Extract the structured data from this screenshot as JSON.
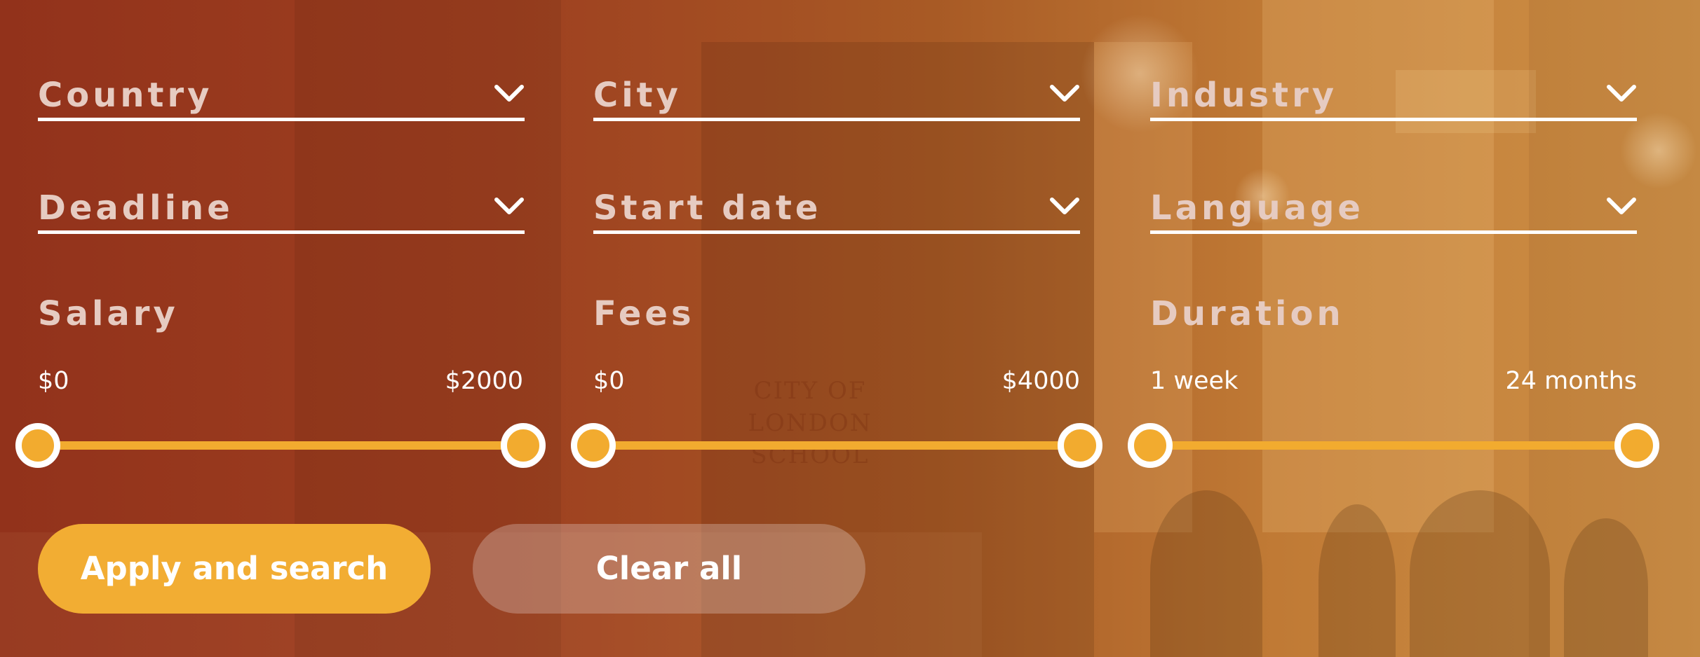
{
  "colors": {
    "accent": "#f2ab2f",
    "label": "#e6cbc1",
    "underline": "#ffffff",
    "background_left": "#92321b",
    "background_right": "#cf9248"
  },
  "background_sign": {
    "line1": "CITY OF LONDON",
    "line2": "SCHOOL"
  },
  "filters": {
    "country": {
      "label": "Country",
      "icon": "chevron-down-icon"
    },
    "city": {
      "label": "City",
      "icon": "chevron-down-icon"
    },
    "industry": {
      "label": "Industry",
      "icon": "chevron-down-icon"
    },
    "deadline": {
      "label": "Deadline",
      "icon": "chevron-down-icon"
    },
    "start_date": {
      "label": "Start date",
      "icon": "chevron-down-icon"
    },
    "language": {
      "label": "Language",
      "icon": "chevron-down-icon"
    }
  },
  "ranges": {
    "salary": {
      "title": "Salary",
      "min_label": "$0",
      "max_label": "$2000",
      "low_fraction": 0,
      "high_fraction": 1
    },
    "fees": {
      "title": "Fees",
      "min_label": "$0",
      "max_label": "$4000",
      "low_fraction": 0,
      "high_fraction": 1
    },
    "duration": {
      "title": "Duration",
      "min_label": "1 week",
      "max_label": "24 months",
      "low_fraction": 0,
      "high_fraction": 1
    }
  },
  "actions": {
    "apply_label": "Apply and search",
    "clear_label": "Clear all"
  }
}
